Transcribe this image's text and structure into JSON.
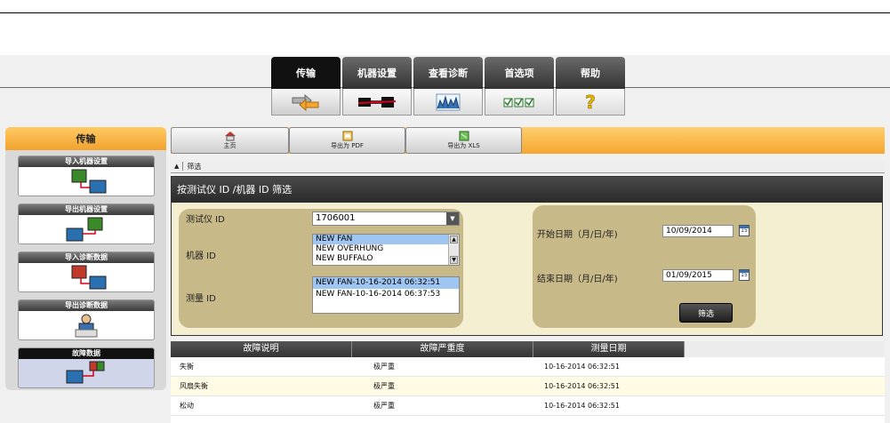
{
  "tabs": [
    {
      "label": "传输",
      "icon": "transfer-icon",
      "active": true
    },
    {
      "label": "机器设置",
      "icon": "machine-setup-icon",
      "active": false
    },
    {
      "label": "查看诊断",
      "icon": "view-diagnosis-icon",
      "active": false
    },
    {
      "label": "首选项",
      "icon": "preferences-icon",
      "active": false
    },
    {
      "label": "帮助",
      "icon": "help-icon",
      "active": false
    }
  ],
  "left_panel": {
    "title": "传输",
    "items": [
      {
        "label": "导入机器设置"
      },
      {
        "label": "导出机器设置"
      },
      {
        "label": "导入诊断数据"
      },
      {
        "label": "导出诊断数据"
      },
      {
        "label": "故障数据"
      }
    ]
  },
  "toolbar": {
    "home_label": "主页",
    "pdf_label": "导出为 PDF",
    "xls_label": "导出为 XLS"
  },
  "filter_bar": {
    "label": "筛选"
  },
  "filter_panel": {
    "title": "按测试仪 ID /机器 ID 筛选",
    "tester_id_label": "测试仪 ID",
    "tester_id_value": "1706001",
    "machine_id_label": "机器 ID",
    "machine_id_options": [
      "NEW FAN",
      "NEW OVERHUNG",
      "NEW BUFFALO"
    ],
    "machine_id_selected": "NEW FAN",
    "measure_id_label": "测量 ID",
    "measure_id_options": [
      "NEW FAN-10-16-2014 06:32:51",
      "NEW FAN-10-16-2014 06:37:53"
    ],
    "measure_id_selected": "NEW FAN-10-16-2014 06:32:51",
    "start_date_label": "开始日期（月/日/年)",
    "start_date_value": "10/09/2014",
    "end_date_label": "结束日期（月/日/年)",
    "end_date_value": "01/09/2015",
    "calendar_day": "15",
    "filter_button": "筛选"
  },
  "table": {
    "columns": [
      "故障说明",
      "故障严重度",
      "测量日期"
    ],
    "rows": [
      [
        "失衡",
        "极严重",
        "10-16-2014 06:32:51"
      ],
      [
        "风扇失衡",
        "极严重",
        "10-16-2014 06:32:51"
      ],
      [
        "松动",
        "极严重",
        "10-16-2014 06:32:51"
      ]
    ]
  },
  "colors": {
    "accent_orange": "#f5a631",
    "panel_tan": "#c8b989",
    "selection_blue": "#9fc5f2"
  }
}
